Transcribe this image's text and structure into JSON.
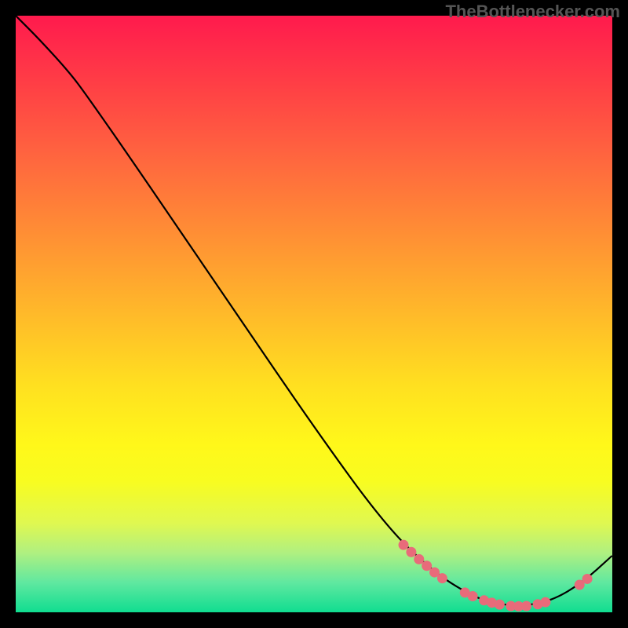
{
  "attribution": "TheBottlenecker.com",
  "chart_data": {
    "type": "line",
    "title": "",
    "xlabel": "",
    "ylabel": "",
    "xlim": [
      0,
      100
    ],
    "ylim": [
      0,
      100
    ],
    "curve": [
      {
        "x": 0,
        "y": 100
      },
      {
        "x": 4,
        "y": 96
      },
      {
        "x": 9,
        "y": 90.5
      },
      {
        "x": 12,
        "y": 86.5
      },
      {
        "x": 20,
        "y": 75
      },
      {
        "x": 35,
        "y": 53
      },
      {
        "x": 50,
        "y": 31
      },
      {
        "x": 62,
        "y": 14.5
      },
      {
        "x": 70,
        "y": 6.8
      },
      {
        "x": 76,
        "y": 3
      },
      {
        "x": 80,
        "y": 1.5
      },
      {
        "x": 85,
        "y": 1
      },
      {
        "x": 90,
        "y": 2
      },
      {
        "x": 95,
        "y": 5
      },
      {
        "x": 100,
        "y": 9.5
      }
    ],
    "markers": [
      {
        "x": 65,
        "y": 11.3
      },
      {
        "x": 66.3,
        "y": 10.1
      },
      {
        "x": 67.6,
        "y": 8.9
      },
      {
        "x": 68.9,
        "y": 7.8
      },
      {
        "x": 70.2,
        "y": 6.7
      },
      {
        "x": 71.5,
        "y": 5.7
      },
      {
        "x": 75.3,
        "y": 3.3
      },
      {
        "x": 76.6,
        "y": 2.7
      },
      {
        "x": 78.5,
        "y": 2.0
      },
      {
        "x": 79.8,
        "y": 1.6
      },
      {
        "x": 81.1,
        "y": 1.3
      },
      {
        "x": 83.0,
        "y": 1.05
      },
      {
        "x": 84.3,
        "y": 1.0
      },
      {
        "x": 85.6,
        "y": 1.05
      },
      {
        "x": 87.5,
        "y": 1.35
      },
      {
        "x": 88.8,
        "y": 1.7
      },
      {
        "x": 94.5,
        "y": 4.6
      },
      {
        "x": 95.8,
        "y": 5.6
      }
    ],
    "marker_color": "#e86b7a",
    "curve_color": "#000000"
  }
}
